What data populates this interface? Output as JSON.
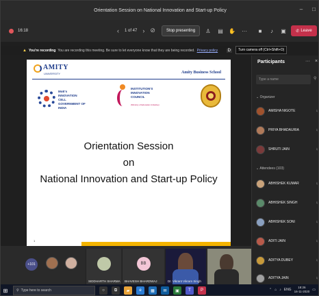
{
  "window": {
    "title": "Orientation Session on National Innovation and Start-up Policy"
  },
  "toolbar": {
    "timer": "16:18",
    "page_indicator": "1 of 47",
    "stop_presenting": "Stop presenting",
    "leave": "Leave",
    "tooltip": "Turn camera off (Ctrl+Shift+O)"
  },
  "banner": {
    "bold": "You're recording",
    "text": "You are recording this meeting. Be sure to let everyone know that they are being recorded.",
    "link": "Privacy policy"
  },
  "slide": {
    "brand": "AMITY",
    "brand_sub": "UNIVERSITY",
    "school": "Amity Business School",
    "mic_lines": [
      "MoE's",
      "INNOVATION CELL",
      "GOVERNMENT OF INDIA"
    ],
    "iic_lines": [
      "INSTITUTION'S",
      "INNOVATION",
      "COUNCIL"
    ],
    "iic_tagline": "(Ministry of Education Initiative)",
    "line1": "Orientation Session",
    "line2": "on",
    "line3": "National Innovation and Start-up Policy",
    "number": "1"
  },
  "participants": {
    "title": "Participants",
    "search_placeholder": "Type a name",
    "organizer_label": "Organizer",
    "presenters": [
      "AMISHA NIGOTE",
      "PRIYA BHADAURIA",
      "SHRUTI JAIN"
    ],
    "attendees_label": "Attendees (103)",
    "attendees": [
      "ABHISHEK KUMAR",
      "ABHISHEK SINGH",
      "ABHISHEK SONI",
      "ADITI JAIN",
      "ADITYA DUBEY",
      "ADITYA JAIN"
    ]
  },
  "video_strip": {
    "overflow_count": "+101",
    "tiles": [
      "SIDDHARTH SHARMA",
      "BHAVESH BHARDWAJ",
      "Dr. Vikrant Vikram Singh"
    ],
    "initials": "BB"
  },
  "taskbar": {
    "search_placeholder": "Type here to search",
    "lang": "ENG",
    "time": "18:26",
    "date": "16-11-2020"
  },
  "colors": {
    "leave": "#c4314b",
    "accent": "#4a4f8a",
    "slide_bar": "#f4b400",
    "recording": "#e0565b"
  }
}
